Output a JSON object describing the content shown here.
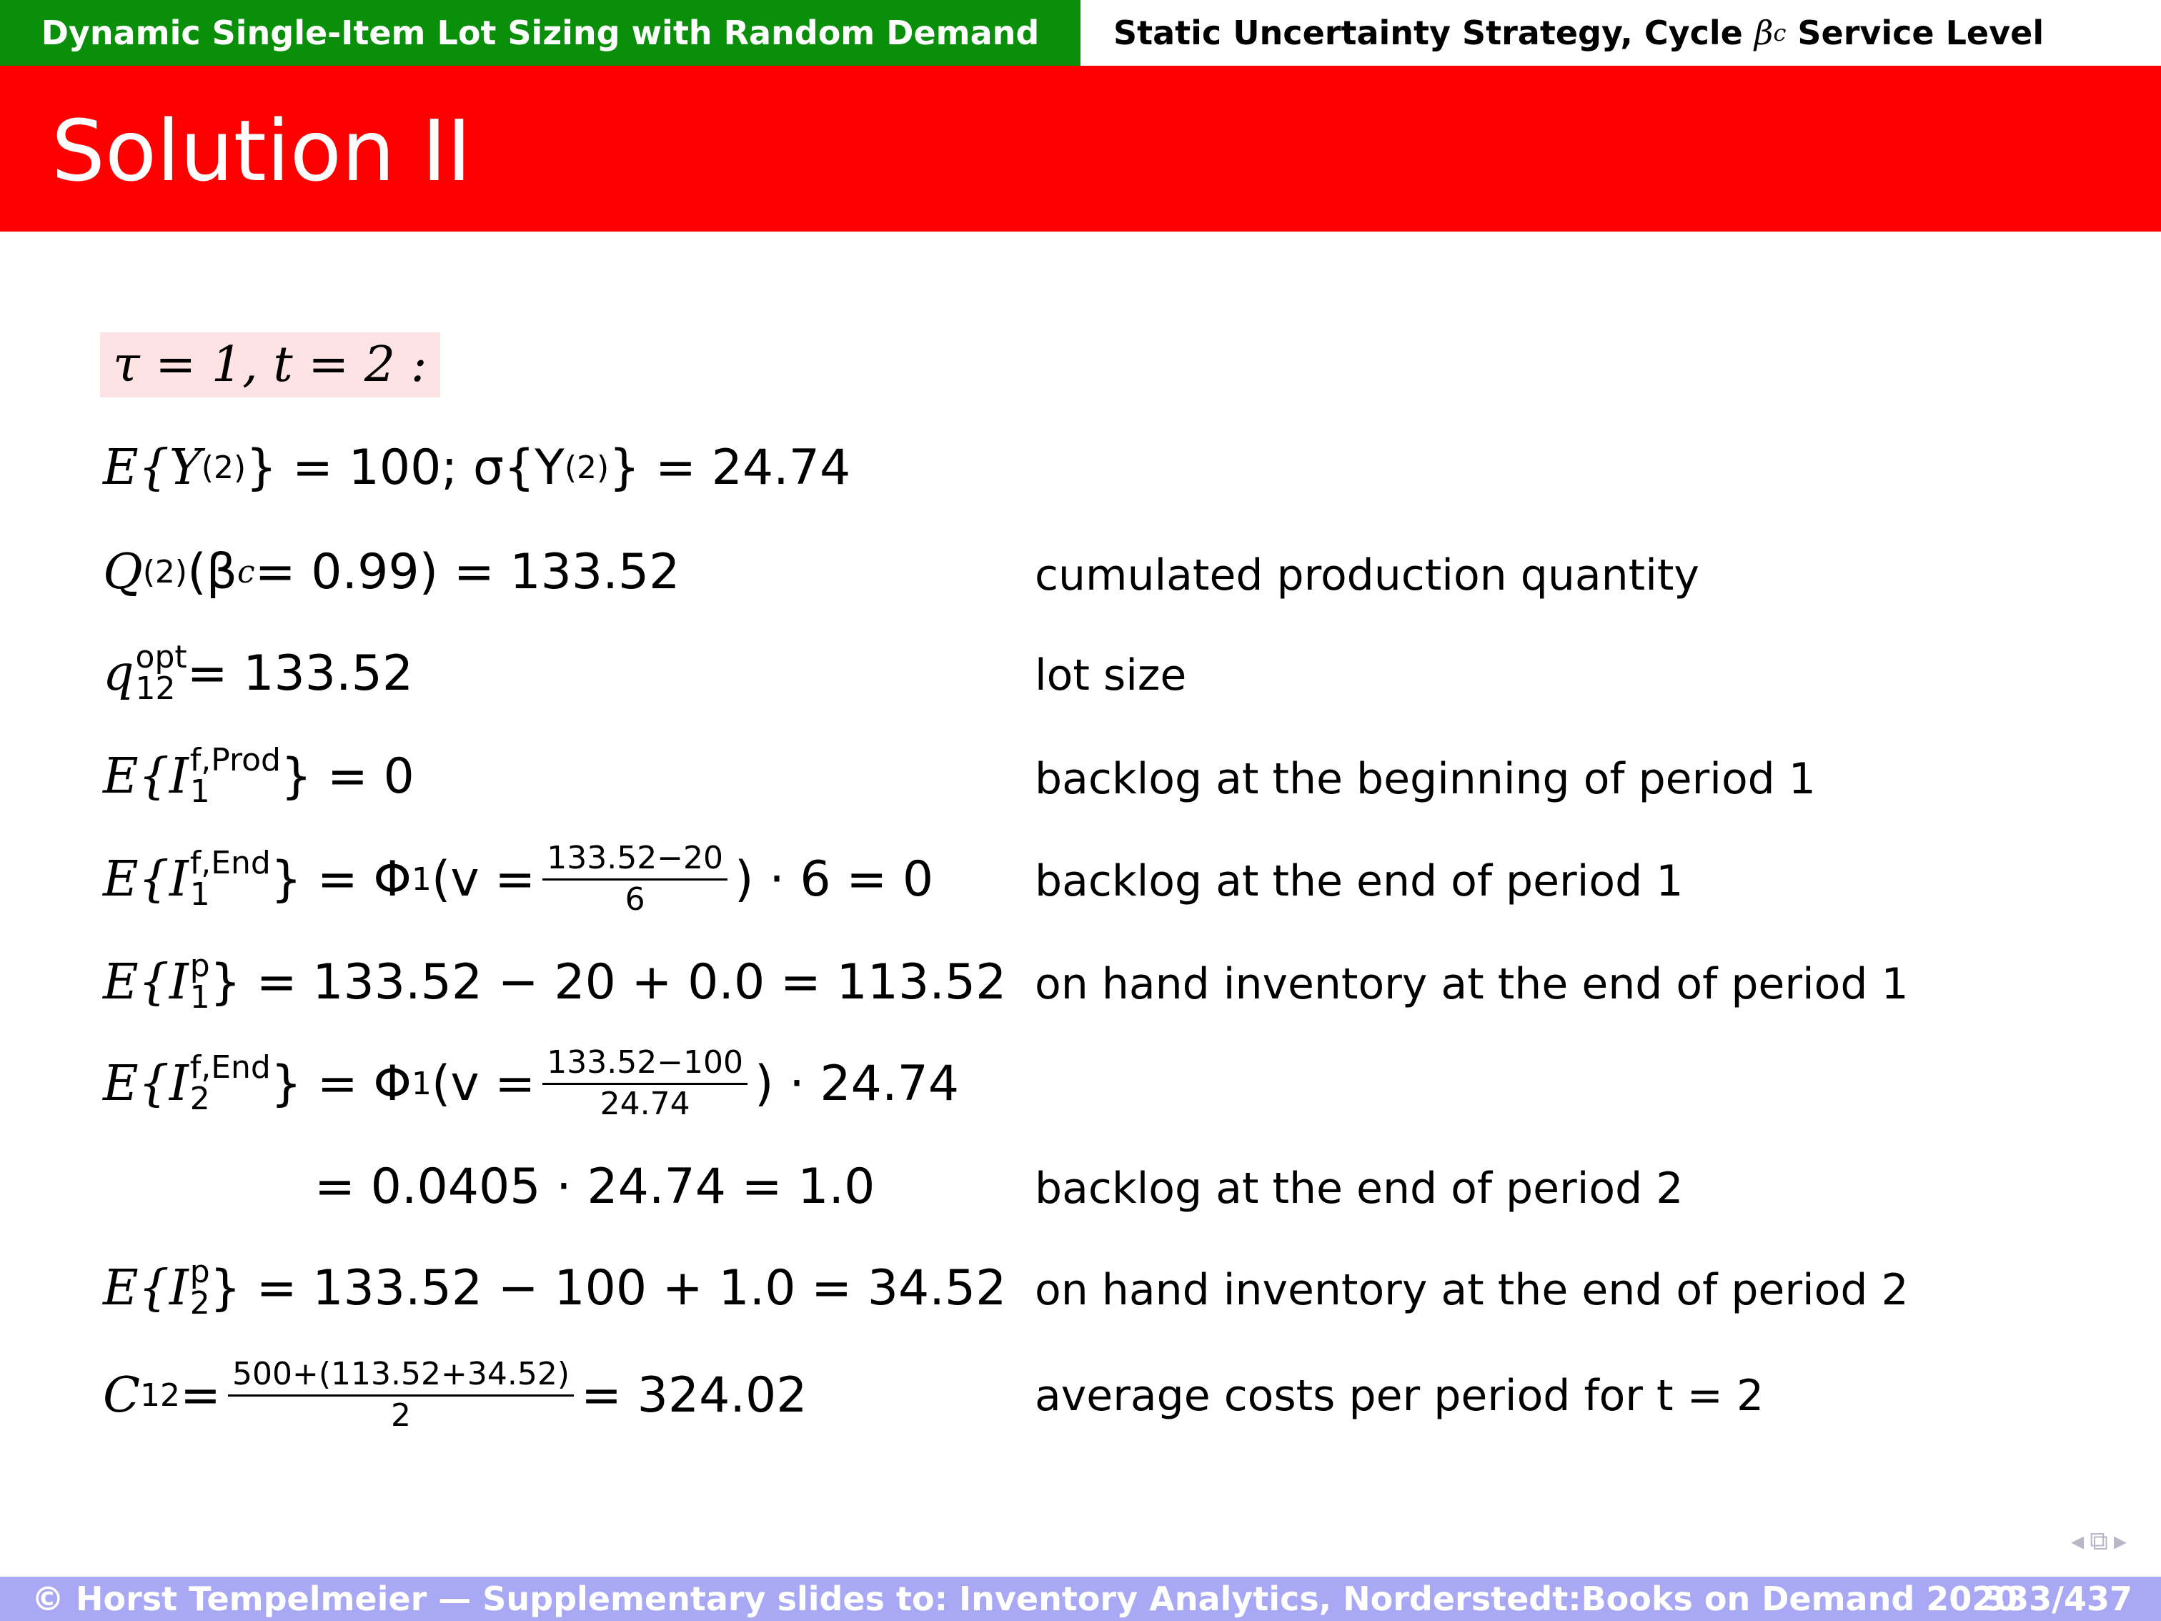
{
  "header": {
    "left_title": "Dynamic Single-Item Lot Sizing with Random Demand",
    "right_title_prefix": "Static Uncertainty Strategy, Cycle",
    "right_title_symbol": "β",
    "right_title_symbol_sub": "c",
    "right_title_suffix": "Service Level"
  },
  "slide": {
    "title": "Solution II"
  },
  "lines": {
    "tau": "τ = 1, t = 2 :",
    "l1_a": "E{Y",
    "l1_sup1": "(2)",
    "l1_b": "} = 100; σ{Y",
    "l1_sup2": "(2)",
    "l1_c": "} = 24.74",
    "l2_a": "Q",
    "l2_sup": "(2)",
    "l2_b": "(β",
    "l2_sub": "c",
    "l2_c": " = 0.99) = 133.52",
    "l2_desc": "cumulated production quantity",
    "l3_a": "q",
    "l3_sup": "opt",
    "l3_sub": "12",
    "l3_b": " = 133.52",
    "l3_desc": "lot size",
    "l4_a": "E{I",
    "l4_sup": "f,Prod",
    "l4_sub": "1",
    "l4_b": "} = 0",
    "l4_desc": "backlog at the beginning of period 1",
    "l5_a": "E{I",
    "l5_sup": "f,End",
    "l5_sub": "1",
    "l5_b": "} = Φ",
    "l5_phisup": "1",
    "l5_c": "(v = ",
    "l5_num": "133.52−20",
    "l5_den": "6",
    "l5_d": ") · 6 = 0",
    "l5_desc": "backlog at the end of period 1",
    "l6_a": "E{I",
    "l6_sup": "p",
    "l6_sub": "1",
    "l6_b": "} = 133.52 − 20 + 0.0 = 113.52",
    "l6_desc": "on hand inventory at the end of period 1",
    "l7_a": "E{I",
    "l7_sup": "f,End",
    "l7_sub": "2",
    "l7_b": "} = Φ",
    "l7_phisup": "1",
    "l7_c": "(v = ",
    "l7_num": "133.52−100",
    "l7_den": "24.74",
    "l7_d": ") · 24.74",
    "l8": "= 0.0405 · 24.74 = 1.0",
    "l8_desc": "backlog at the end of period 2",
    "l9_a": "E{I",
    "l9_sup": "p",
    "l9_sub": "2",
    "l9_b": "} = 133.52 − 100 + 1.0 = 34.52",
    "l9_desc": "on hand inventory at the end of period 2",
    "l10_a": "C",
    "l10_sub": "12",
    "l10_b": " = ",
    "l10_num": "500+(113.52+34.52)",
    "l10_den": "2",
    "l10_c": " = 324.02",
    "l10_desc": "average costs per period for t = 2"
  },
  "footer": {
    "text": "© Horst Tempelmeier — Supplementary slides to: Inventory Analytics, Norderstedt:Books on Demand 2020",
    "page": "333/437"
  }
}
